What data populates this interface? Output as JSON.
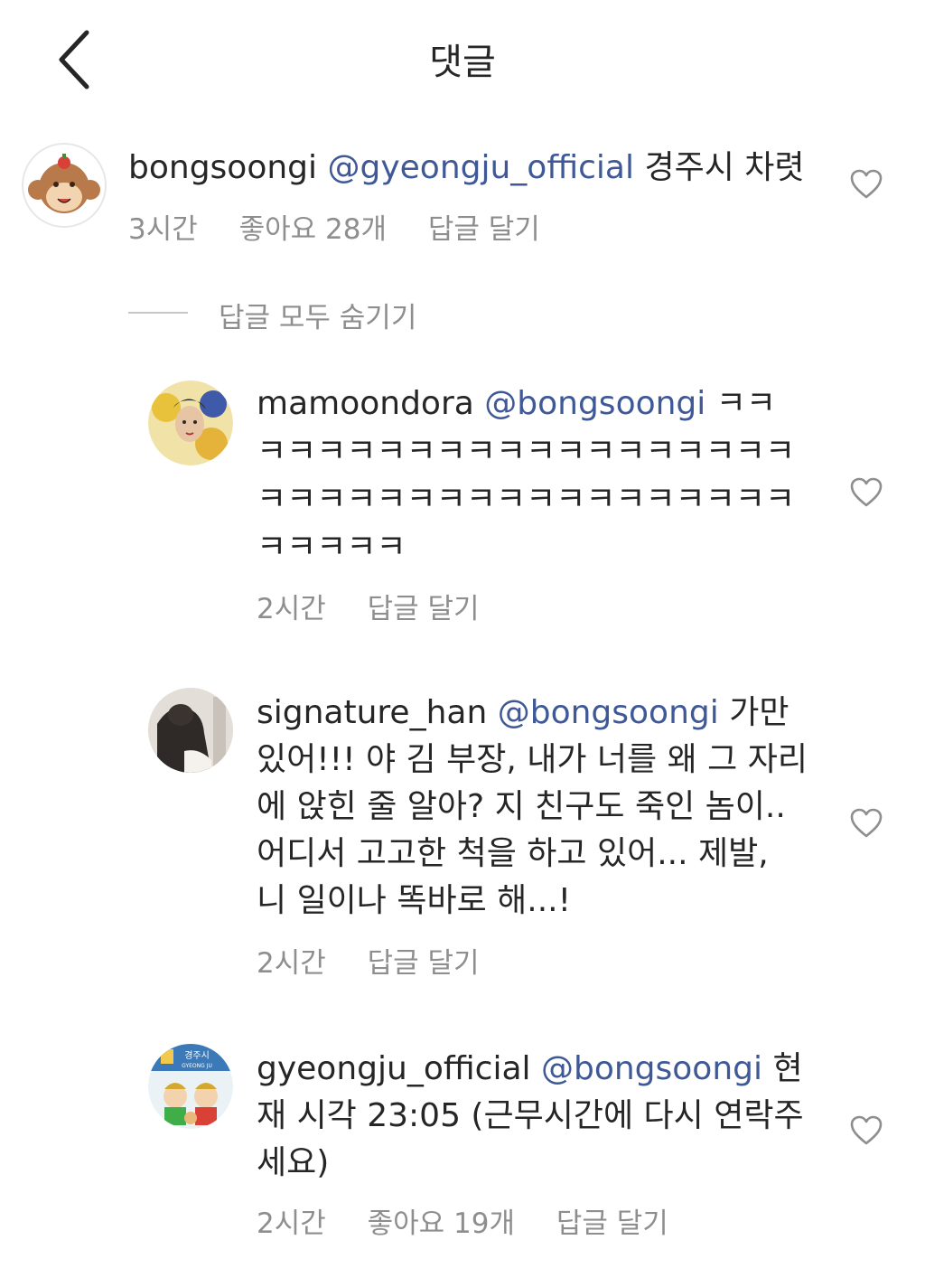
{
  "header": {
    "title": "댓글"
  },
  "main_comment": {
    "username": "bongsoongi",
    "mention": "@gyeongju_official",
    "text": "경주시 차렷",
    "time": "3시간",
    "likes": "좋아요 28개",
    "reply": "답글 달기"
  },
  "hide_replies": "답글 모두 숨기기",
  "replies": [
    {
      "username": "mamoondora",
      "mention": "@bongsoongi",
      "text": "ㅋㅋㅋㅋㅋㅋㅋㅋㅋㅋㅋㅋㅋㅋㅋㅋㅋㅋㅋㅋㅋㅋㅋㅋㅋㅋㅋㅋㅋㅋㅋㅋㅋㅋㅋㅋㅋㅋㅋㅋㅋㅋㅋ",
      "time": "2시간",
      "reply": "답글 달기"
    },
    {
      "username": "signature_han",
      "mention": "@bongsoongi",
      "text": "가만 있어!!! 야 김 부장, 내가 너를 왜 그 자리에 앉힌 줄 알아? 지 친구도 죽인 놈이.. 어디서 고고한 척을 하고 있어... 제발, 니 일이나 똑바로 해...!",
      "time": "2시간",
      "reply": "답글 달기"
    },
    {
      "username": "gyeongju_official",
      "mention": "@bongsoongi",
      "text": "현재 시각 23:05 (근무시간에 다시 연락주세요)",
      "avatar_text": "경주시",
      "avatar_subtext": "GYEONG JU",
      "time": "2시간",
      "likes": "좋아요 19개",
      "reply": "답글 달기"
    }
  ],
  "icons": {
    "back": "chevron-left-icon",
    "like": "heart-outline-icon"
  },
  "colors": {
    "mention": "#3f5897",
    "meta": "#8e8e8e",
    "text": "#262626"
  }
}
